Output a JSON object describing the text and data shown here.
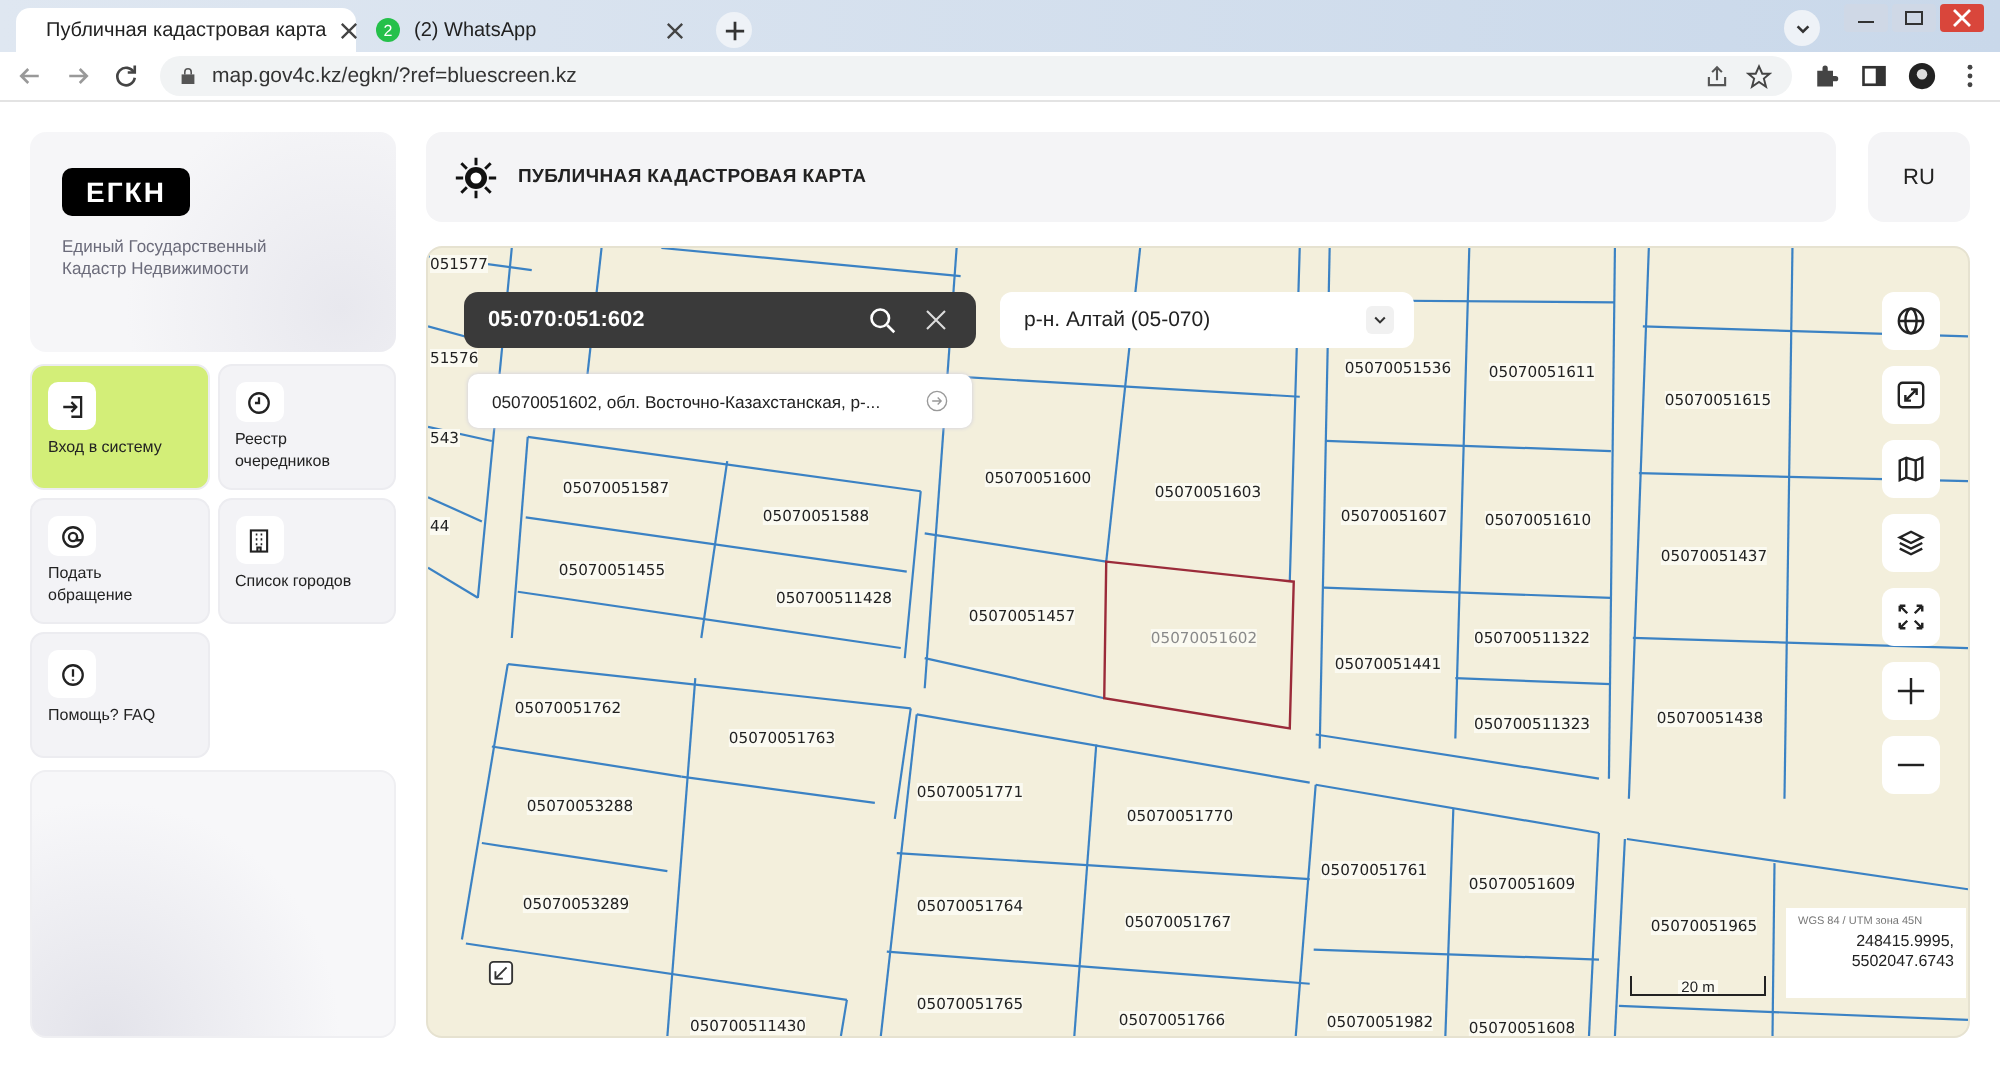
{
  "browser": {
    "tabs": [
      {
        "title": "Публичная кадастровая карта",
        "selected": true,
        "kind": "cadastre"
      },
      {
        "title": "(2) WhatsApp",
        "selected": false,
        "kind": "whatsapp",
        "favicon_badge": "2"
      }
    ],
    "address": "map.gov4c.kz/egkn/?ref=bluescreen.kz"
  },
  "sidebar": {
    "logo": "ЕГКН",
    "subtitle": "Единый Государственный Кадастр Недвижимости",
    "tiles": [
      {
        "label": "Вход в систему",
        "selected": true,
        "kind": "login"
      },
      {
        "label": "Реестр очередников",
        "selected": false,
        "kind": "clock"
      },
      {
        "label": "Подать обращение",
        "selected": false,
        "kind": "appeal"
      },
      {
        "label": "Список городов",
        "selected": false,
        "kind": "building"
      },
      {
        "label": "Помощь? FAQ",
        "selected": false,
        "kind": "help"
      }
    ]
  },
  "header": {
    "title": "ПУБЛИЧНАЯ КАДАСТРОВАЯ КАРТА",
    "language": "RU"
  },
  "map": {
    "search": "05:070:051:602",
    "suggestion": "05070051602, обл. Восточно-Казахстанская, р-...",
    "district": "р-н. Алтай (05-070)",
    "parcels": [
      {
        "number": "051577",
        "selected": false
      },
      {
        "number": "51576",
        "selected": false
      },
      {
        "number": "543",
        "selected": false
      },
      {
        "number": "44",
        "selected": false
      },
      {
        "number": "05070051587",
        "selected": false
      },
      {
        "number": "05070051588",
        "selected": false
      },
      {
        "number": "05070051455",
        "selected": false
      },
      {
        "number": "050700511428",
        "selected": false
      },
      {
        "number": "05070051600",
        "selected": false
      },
      {
        "number": "05070051603",
        "selected": false
      },
      {
        "number": "05070051457",
        "selected": false
      },
      {
        "number": "05070051602",
        "selected": true
      },
      {
        "number": "05070051536",
        "selected": false
      },
      {
        "number": "05070051611",
        "selected": false
      },
      {
        "number": "05070051607",
        "selected": false
      },
      {
        "number": "05070051610",
        "selected": false
      },
      {
        "number": "05070051441",
        "selected": false
      },
      {
        "number": "050700511322",
        "selected": false
      },
      {
        "number": "050700511323",
        "selected": false
      },
      {
        "number": "05070051615",
        "selected": false
      },
      {
        "number": "05070051437",
        "selected": false
      },
      {
        "number": "05070051438",
        "selected": false
      },
      {
        "number": "05070051762",
        "selected": false
      },
      {
        "number": "05070051763",
        "selected": false
      },
      {
        "number": "05070053288",
        "selected": false
      },
      {
        "number": "05070053289",
        "selected": false
      },
      {
        "number": "05070051771",
        "selected": false
      },
      {
        "number": "05070051770",
        "selected": false
      },
      {
        "number": "05070051764",
        "selected": false
      },
      {
        "number": "05070051767",
        "selected": false
      },
      {
        "number": "05070051765",
        "selected": false
      },
      {
        "number": "05070051766",
        "selected": false
      },
      {
        "number": "050700511430",
        "selected": false
      },
      {
        "number": "05070051761",
        "selected": false
      },
      {
        "number": "05070051609",
        "selected": false
      },
      {
        "number": "05070051965",
        "selected": false
      },
      {
        "number": "05070051982",
        "selected": false
      },
      {
        "number": "05070051608",
        "selected": false
      }
    ],
    "controls": [
      {
        "kind": "globe"
      },
      {
        "kind": "zoom-extent"
      },
      {
        "kind": "map"
      },
      {
        "kind": "layers"
      },
      {
        "kind": "fullscreen"
      },
      {
        "kind": "zoom-in"
      },
      {
        "kind": "zoom-out"
      }
    ],
    "scale": "20 m",
    "crs": "WGS 84 / UTM зона 45N",
    "coordinates": "248415.9995, 5502047.6743"
  }
}
